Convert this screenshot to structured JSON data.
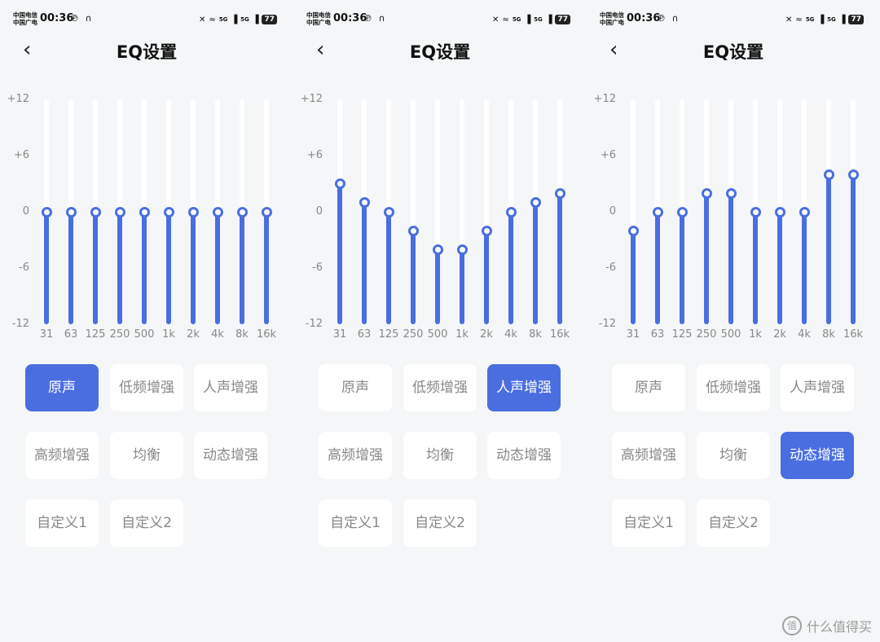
{
  "status_bar": {
    "carrier1": "中国电信",
    "carrier2": "中国广电",
    "time": "00:36",
    "signal1": "5G",
    "signal2": "5G",
    "battery": "77"
  },
  "header": {
    "title": "EQ设置",
    "back_icon": "chevron-left-icon"
  },
  "eq": {
    "y_labels": [
      "+12",
      "+6",
      "0",
      "-6",
      "-12"
    ],
    "bands": [
      "31",
      "63",
      "125",
      "250",
      "500",
      "1k",
      "2k",
      "4k",
      "8k",
      "16k"
    ],
    "range": [
      -12,
      12
    ]
  },
  "presets": [
    "原声",
    "低频增强",
    "人声增强",
    "高频增强",
    "均衡",
    "动态增强",
    "自定义1",
    "自定义2"
  ],
  "accent_color": "#4a6ee0",
  "panels": [
    {
      "active_preset": 0,
      "values": [
        0,
        0,
        0,
        0,
        0,
        0,
        0,
        0,
        0,
        0
      ]
    },
    {
      "active_preset": 2,
      "values": [
        3,
        1,
        0,
        -2,
        -4,
        -4,
        -2,
        0,
        1,
        2
      ]
    },
    {
      "active_preset": 5,
      "values": [
        -2,
        0,
        0,
        2,
        2,
        0,
        0,
        0,
        4,
        4
      ]
    }
  ],
  "watermark": {
    "logo": "值",
    "text": "什么值得买"
  }
}
